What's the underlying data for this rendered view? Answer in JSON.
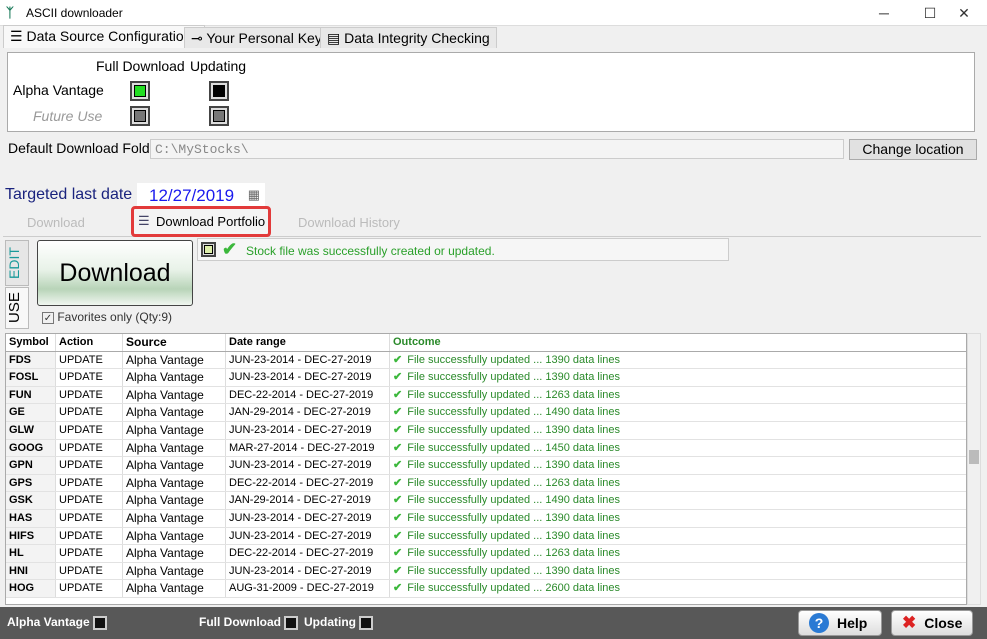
{
  "window": {
    "title": "ASCII downloader",
    "minimize": "─",
    "maximize": "☐",
    "close": "✕"
  },
  "top_tabs": [
    {
      "label": "Data Source Configurations",
      "icon": "list-icon"
    },
    {
      "label": "Your Personal Keys",
      "icon": "key-icon"
    },
    {
      "label": "Data Integrity Checking",
      "icon": "calendar-icon"
    }
  ],
  "config": {
    "col_full": "Full Download",
    "col_updating": "Updating",
    "rows": [
      {
        "label": "Alpha Vantage",
        "full": "#22dd22",
        "updating": "#000000"
      },
      {
        "label": "Future Use",
        "full": "#777777",
        "updating": "#777777"
      }
    ]
  },
  "folder": {
    "label": "Default Download Folder",
    "value": "C:\\MyStocks\\",
    "change_label": "Change location"
  },
  "target": {
    "label": "Targeted last date",
    "date": "12/27/2019"
  },
  "sub_tabs": [
    {
      "label": "Download Symbol"
    },
    {
      "label": "Download Portfolio"
    },
    {
      "label": "Download History"
    }
  ],
  "side_tabs": {
    "edit": "EDIT",
    "use": "USE"
  },
  "download": {
    "label": "Download",
    "favorites": "Favorites only (Qty:9)"
  },
  "status": {
    "message": "Stock file was successfully created or updated."
  },
  "table": {
    "headers": [
      "Symbol",
      "Action",
      "Source",
      "Date range",
      "Outcome"
    ],
    "rows": [
      [
        "FDS",
        "UPDATE",
        "Alpha Vantage",
        "JUN-23-2014 - DEC-27-2019",
        "File successfully updated ...  1390 data lines"
      ],
      [
        "FOSL",
        "UPDATE",
        "Alpha Vantage",
        "JUN-23-2014 - DEC-27-2019",
        "File successfully updated ...  1390 data lines"
      ],
      [
        "FUN",
        "UPDATE",
        "Alpha Vantage",
        "DEC-22-2014 - DEC-27-2019",
        "File successfully updated ...  1263 data lines"
      ],
      [
        "GE",
        "UPDATE",
        "Alpha Vantage",
        "JAN-29-2014 - DEC-27-2019",
        "File successfully updated ...  1490 data lines"
      ],
      [
        "GLW",
        "UPDATE",
        "Alpha Vantage",
        "JUN-23-2014 - DEC-27-2019",
        "File successfully updated ...  1390 data lines"
      ],
      [
        "GOOG",
        "UPDATE",
        "Alpha Vantage",
        "MAR-27-2014 - DEC-27-2019",
        "File successfully updated ...  1450 data lines"
      ],
      [
        "GPN",
        "UPDATE",
        "Alpha Vantage",
        "JUN-23-2014 - DEC-27-2019",
        "File successfully updated ...  1390 data lines"
      ],
      [
        "GPS",
        "UPDATE",
        "Alpha Vantage",
        "DEC-22-2014 - DEC-27-2019",
        "File successfully updated ...  1263 data lines"
      ],
      [
        "GSK",
        "UPDATE",
        "Alpha Vantage",
        "JAN-29-2014 - DEC-27-2019",
        "File successfully updated ...  1490 data lines"
      ],
      [
        "HAS",
        "UPDATE",
        "Alpha Vantage",
        "JUN-23-2014 - DEC-27-2019",
        "File successfully updated ...  1390 data lines"
      ],
      [
        "HIFS",
        "UPDATE",
        "Alpha Vantage",
        "JUN-23-2014 - DEC-27-2019",
        "File successfully updated ...  1390 data lines"
      ],
      [
        "HL",
        "UPDATE",
        "Alpha Vantage",
        "DEC-22-2014 - DEC-27-2019",
        "File successfully updated ...  1263 data lines"
      ],
      [
        "HNI",
        "UPDATE",
        "Alpha Vantage",
        "JUN-23-2014 - DEC-27-2019",
        "File successfully updated ...  1390 data lines"
      ],
      [
        "HOG",
        "UPDATE",
        "Alpha Vantage",
        "AUG-31-2009 - DEC-27-2019",
        "File successfully updated ...  2600 data lines"
      ]
    ]
  },
  "bottom": {
    "alpha": "Alpha Vantage",
    "full": "Full Download",
    "updating": "Updating",
    "help": "Help",
    "close": "Close"
  }
}
